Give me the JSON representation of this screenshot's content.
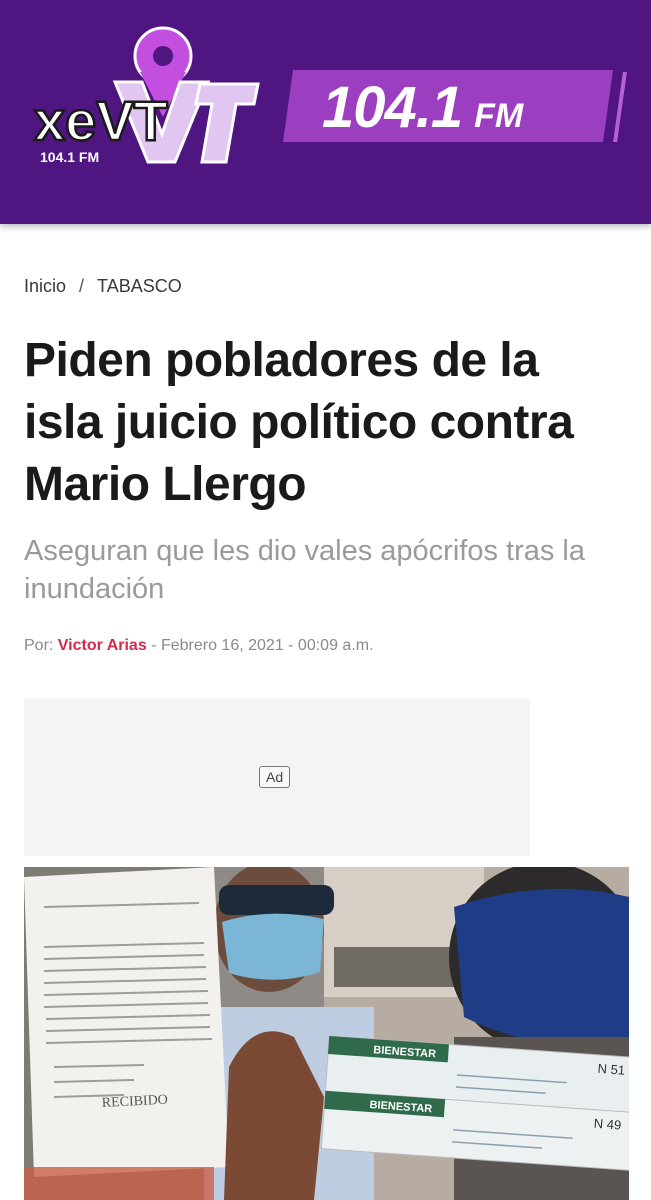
{
  "header": {
    "logo": {
      "main": "xeVT",
      "sub": "104.1 FM"
    },
    "frequency": "104.1",
    "band": "FM",
    "colors": {
      "background": "#4f1682",
      "accent": "#9b3fc0",
      "pin": "#c24fe0"
    }
  },
  "breadcrumb": {
    "home": "Inicio",
    "separator": "/",
    "section": "TABASCO"
  },
  "article": {
    "title": "Piden pobladores de la isla juicio político contra Mario Llergo",
    "subtitle": "Aseguran que les dio vales apócrifos tras la inundación",
    "byline": {
      "prefix": "Por:",
      "author": "Victor Arias",
      "date": "- Febrero 16, 2021 - 00:09 a.m."
    }
  },
  "ad": {
    "label": "Ad"
  },
  "photo": {
    "vouchers": [
      {
        "brand": "BIENESTAR",
        "number": "N 51"
      },
      {
        "brand": "BIENESTAR",
        "number": "N 49"
      }
    ],
    "document_stamp": "RECIBIDO"
  }
}
